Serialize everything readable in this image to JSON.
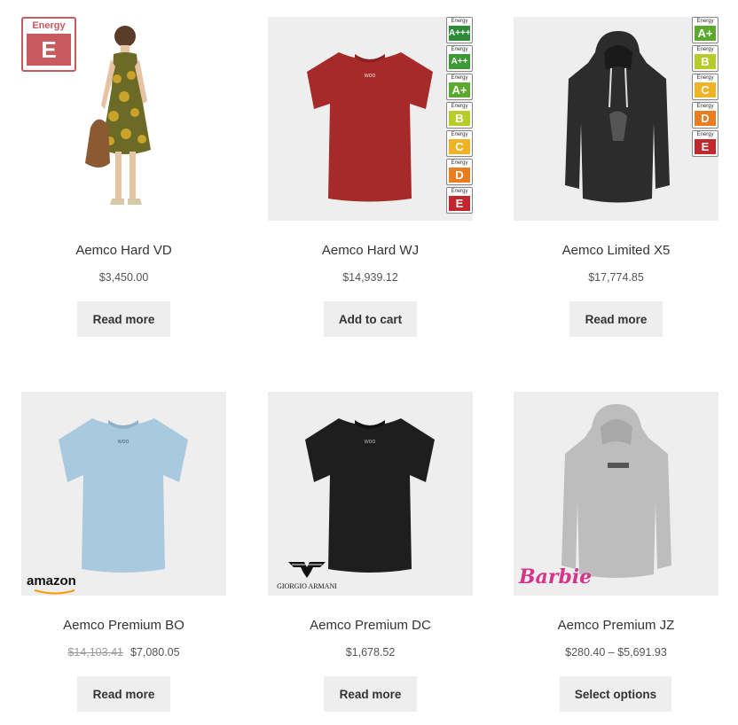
{
  "products": [
    {
      "title": "Aemco Hard VD",
      "price": "$3,450.00",
      "button": "Read more",
      "badge": {
        "energy_word": "Energy",
        "grade": "E"
      }
    },
    {
      "title": "Aemco Hard WJ",
      "price": "$14,939.12",
      "button": "Add to cart",
      "tee_print": "woo",
      "ladder": [
        {
          "word": "Energy",
          "grade": "A+++"
        },
        {
          "word": "Energy",
          "grade": "A++"
        },
        {
          "word": "Energy",
          "grade": "A+"
        },
        {
          "word": "Energy",
          "grade": "B"
        },
        {
          "word": "Energy",
          "grade": "C"
        },
        {
          "word": "Energy",
          "grade": "D"
        },
        {
          "word": "Energy",
          "grade": "E"
        }
      ]
    },
    {
      "title": "Aemco Limited X5",
      "price": "$17,774.85",
      "button": "Read more",
      "ladder": [
        {
          "word": "Energy",
          "grade": "A+"
        },
        {
          "word": "Energy",
          "grade": "B"
        },
        {
          "word": "Energy",
          "grade": "C"
        },
        {
          "word": "Energy",
          "grade": "D"
        },
        {
          "word": "Energy",
          "grade": "E"
        }
      ]
    },
    {
      "title": "Aemco Premium BO",
      "old_price": "$14,103.41",
      "price": "$7,080.05",
      "button": "Read more",
      "tee_print": "woo",
      "brand": "amazon"
    },
    {
      "title": "Aemco Premium DC",
      "price": "$1,678.52",
      "button": "Read more",
      "tee_print": "woo",
      "brand": "GIORGIO ARMANI"
    },
    {
      "title": "Aemco Premium JZ",
      "price": "$280.40 – $5,691.93",
      "button": "Select options",
      "brand": "Barbie"
    }
  ],
  "colors": {
    "A+++": "#2e8b3a",
    "A++": "#3c9a35",
    "A+": "#5aaa2e",
    "B": "#b7cc2a",
    "C": "#f0b323",
    "D": "#ea7d1f",
    "E": "#c0282e"
  }
}
